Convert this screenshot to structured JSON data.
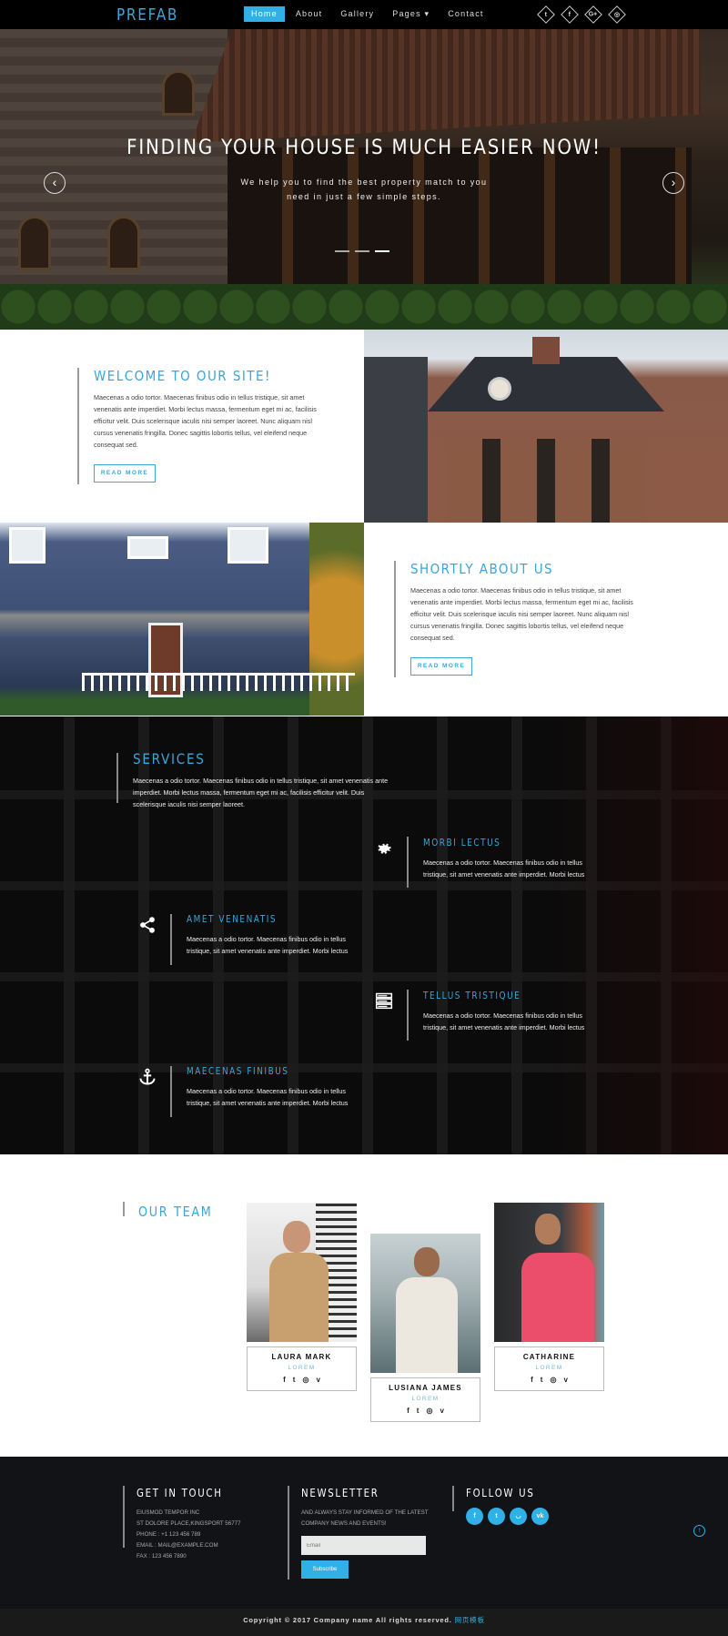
{
  "nav": {
    "logo": "PREFAB",
    "items": [
      {
        "label": "Home",
        "active": true
      },
      {
        "label": "About",
        "active": false
      },
      {
        "label": "Gallery",
        "active": false
      },
      {
        "label": "Pages ▾",
        "active": false
      },
      {
        "label": "Contact",
        "active": false
      }
    ],
    "social": [
      {
        "icon": "twitter-icon",
        "glyph": "t"
      },
      {
        "icon": "facebook-icon",
        "glyph": "f"
      },
      {
        "icon": "google-plus-icon",
        "glyph": "G+"
      },
      {
        "icon": "dribbble-icon",
        "glyph": "◎"
      }
    ],
    "accent": "#2fb0e6"
  },
  "hero": {
    "title": "FINDING YOUR HOUSE IS MUCH EASIER NOW!",
    "subtitle": "We help you to find the best property match to you need in just a few simple steps.",
    "prev_glyph": "‹",
    "next_glyph": "›",
    "slides_total": 3,
    "active_slide": 3
  },
  "welcome": {
    "title": "WELCOME TO OUR SITE!",
    "body": "Maecenas a odio tortor. Maecenas finibus odio in tellus tristique, sit amet venenatis ante imperdiet. Morbi lectus massa, fermentum eget mi ac, facilisis efficitur velit. Duis scelerisque iaculis nisi semper laoreet. Nunc aliquam nisl cursus venenatis fringilla. Donec sagittis lobortis tellus, vel eleifend neque consequat sed.",
    "button": "READ MORE"
  },
  "about": {
    "title": "SHORTLY ABOUT US",
    "body": "Maecenas a odio tortor. Maecenas finibus odio in tellus tristique, sit amet venenatis ante imperdiet. Morbi lectus massa, fermentum eget mi ac, facilisis efficitur velit. Duis scelerisque iaculis nisi semper laoreet. Nunc aliquam nisl cursus venenatis fringilla. Donec sagittis lobortis tellus, vel eleifend neque consequat sed.",
    "button": "READ MORE"
  },
  "services": {
    "title": "SERVICES",
    "intro": "Maecenas a odio tortor. Maecenas finibus odio in tellus tristique, sit amet venenatis ante imperdiet. Morbi lectus massa, fermentum eget mi ac, facilisis efficitur velit. Duis scelerisque iaculis nisi semper laoreet.",
    "items": [
      {
        "title": "MORBI LECTUS",
        "icon": "gear-icon",
        "body": "Maecenas a odio tortor. Maecenas finibus odio in tellus tristique, sit amet venenatis ante imperdiet. Morbi lectus"
      },
      {
        "title": "AMET VENENATIS",
        "icon": "share-icon",
        "body": "Maecenas a odio tortor. Maecenas finibus odio in tellus tristique, sit amet venenatis ante imperdiet. Morbi lectus"
      },
      {
        "title": "TELLUS TRISTIQUE",
        "icon": "server-icon",
        "body": "Maecenas a odio tortor. Maecenas finibus odio in tellus tristique, sit amet venenatis ante imperdiet. Morbi lectus"
      },
      {
        "title": "MAECENAS FINIBUS",
        "icon": "anchor-icon",
        "body": "Maecenas a odio tortor. Maecenas finibus odio in tellus tristique, sit amet venenatis ante imperdiet. Morbi lectus"
      }
    ]
  },
  "team": {
    "title": "OUR TEAM",
    "members": [
      {
        "name": "LAURA MARK",
        "role": "LOREM",
        "icons": [
          "f",
          "t",
          "◎",
          "v"
        ]
      },
      {
        "name": "LUSIANA JAMES",
        "role": "LOREM",
        "icons": [
          "f",
          "t",
          "◎",
          "v"
        ]
      },
      {
        "name": "CATHARINE",
        "role": "LOREM",
        "icons": [
          "f",
          "t",
          "◎",
          "v"
        ]
      }
    ]
  },
  "footer": {
    "contact": {
      "title": "GET IN TOUCH",
      "lines": [
        "EIUSMOD TEMPOR INC",
        "ST DOLORE PLACE,KINGSPORT 56777",
        "PHONE : +1 123 456 789",
        "EMAIL : MAIL@EXAMPLE.COM",
        "FAX : 123 456 7890"
      ]
    },
    "newsletter": {
      "title": "NEWSLETTER",
      "text": "AND ALWAYS STAY INFORMED OF THE LATEST COMPANY NEWS AND EVENTS!",
      "email_placeholder": "Email",
      "email_value": "",
      "button": "Subscribe"
    },
    "follow": {
      "title": "FOLLOW US",
      "icons": [
        {
          "icon": "facebook-icon",
          "glyph": "f"
        },
        {
          "icon": "twitter-icon",
          "glyph": "t"
        },
        {
          "icon": "rss-icon",
          "glyph": "◡"
        },
        {
          "icon": "vk-icon",
          "glyph": "vk"
        }
      ]
    },
    "to_top_glyph": "↑",
    "copyright": "Copyright © 2017 Company name All rights reserved.",
    "copyright_link": "网页模板"
  }
}
